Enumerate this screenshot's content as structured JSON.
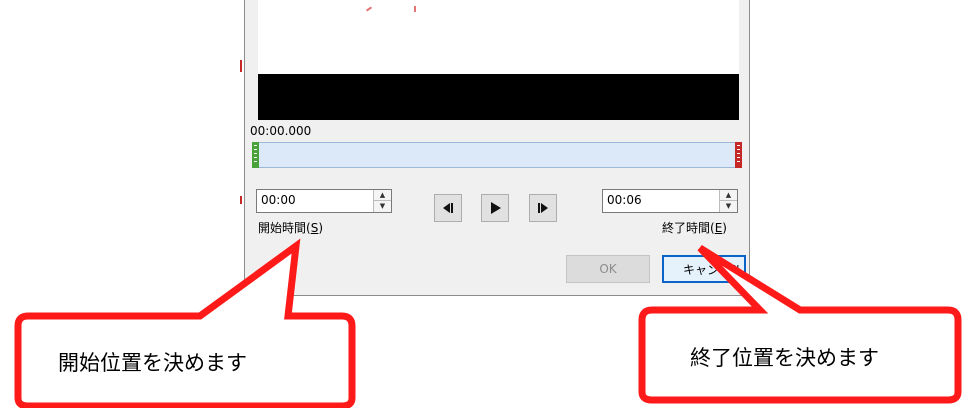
{
  "timeline": {
    "current_time": "00:00.000"
  },
  "start": {
    "value": "00:00",
    "label": "開始時間(S)",
    "label_text": "開始時間(",
    "label_key": "S"
  },
  "end": {
    "value": "00:06",
    "label": "終了時間(E)",
    "label_text": "終了時間(",
    "label_key": "E"
  },
  "playback": {
    "prev_icon": "previous-frame-icon",
    "play_icon": "play-icon",
    "next_icon": "next-frame-icon"
  },
  "buttons": {
    "ok": "OK",
    "cancel": "キャンセル"
  },
  "callouts": {
    "start": "開始位置を決めます",
    "end": "終了位置を決めます"
  },
  "colors": {
    "callout_border": "#ff1a1a",
    "start_handle": "#49a23a",
    "end_handle": "#c62828",
    "timeline": "#dbe9f8"
  }
}
